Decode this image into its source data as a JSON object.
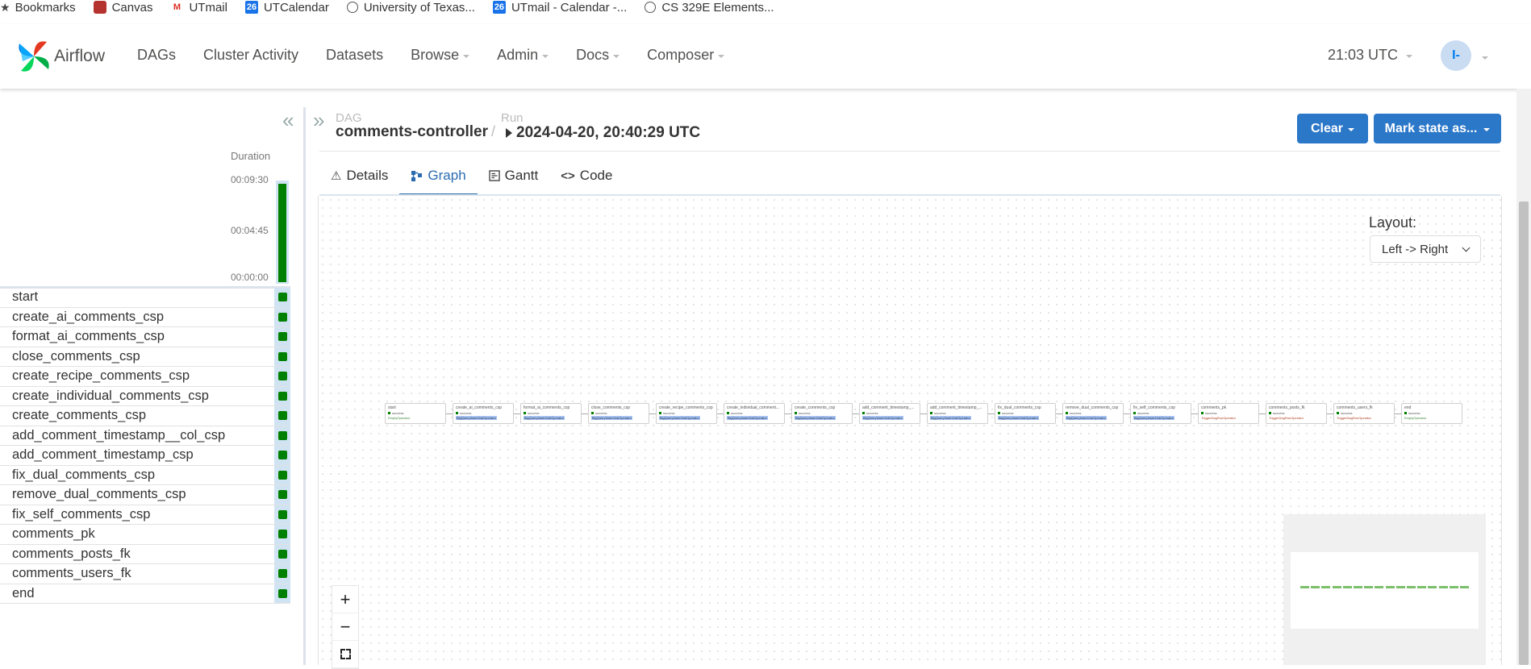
{
  "bookmarks": {
    "items": [
      {
        "label": "Bookmarks",
        "icon": "star-icon"
      },
      {
        "label": "Canvas",
        "icon": "canvas-icon"
      },
      {
        "label": "UTmail",
        "icon": "gmail-icon"
      },
      {
        "label": "UTCalendar",
        "icon": "calendar-icon",
        "badge": "26"
      },
      {
        "label": "University of Texas...",
        "icon": "globe-icon"
      },
      {
        "label": "UTmail - Calendar -...",
        "icon": "calendar-icon",
        "badge": "26"
      },
      {
        "label": "CS 329E Elements...",
        "icon": "globe-icon"
      }
    ]
  },
  "nav": {
    "brand": "Airflow",
    "items": [
      "DAGs",
      "Cluster Activity",
      "Datasets",
      "Browse",
      "Admin",
      "Docs",
      "Composer"
    ],
    "time": "21:03 UTC",
    "user_initials": "I-"
  },
  "grid": {
    "duration_label": "Duration",
    "ticks": [
      "00:09:30",
      "00:04:45",
      "00:00:00"
    ],
    "run_fraction": 1.0,
    "tasks": [
      "start",
      "create_ai_comments_csp",
      "format_ai_comments_csp",
      "close_comments_csp",
      "create_recipe_comments_csp",
      "create_individual_comments_csp",
      "create_comments_csp",
      "add_comment_timestamp__col_csp",
      "add_comment_timestamp_csp",
      "fix_dual_comments_csp",
      "remove_dual_comments_csp",
      "fix_self_comments_csp",
      "comments_pk",
      "comments_posts_fk",
      "comments_users_fk",
      "end"
    ],
    "status_color": "#008000"
  },
  "header": {
    "dag_label": "DAG",
    "dag_id": "comments-controller",
    "separator": "/",
    "run_label": "Run",
    "run_id": "2024-04-20, 20:40:29 UTC",
    "clear_button": "Clear",
    "mark_state_button": "Mark state as..."
  },
  "tabs": [
    {
      "label": "Details",
      "icon": "warning-icon",
      "active": false
    },
    {
      "label": "Graph",
      "icon": "graph-icon",
      "active": true
    },
    {
      "label": "Gantt",
      "icon": "gantt-icon",
      "active": false
    },
    {
      "label": "Code",
      "icon": "code-icon",
      "active": false
    }
  ],
  "graph": {
    "layout_label": "Layout:",
    "layout_value": "Left -> Right",
    "zoom_in": "+",
    "zoom_out": "−",
    "nodes": [
      {
        "name": "start",
        "status": "success",
        "operator": "EmptyOperator",
        "kind": "empty"
      },
      {
        "name": "create_ai_comments_csp",
        "status": "success",
        "operator": "BigQueryInsertJobOperator",
        "kind": "bq"
      },
      {
        "name": "format_ai_comments_csp",
        "status": "success",
        "operator": "BigQueryInsertJobOperator",
        "kind": "bq"
      },
      {
        "name": "close_comments_csp",
        "status": "success",
        "operator": "BigQueryInsertJobOperator",
        "kind": "bq"
      },
      {
        "name": "create_recipe_comments_csp",
        "status": "success",
        "operator": "BigQueryInsertJobOperator",
        "kind": "bq"
      },
      {
        "name": "create_individual_comment...",
        "status": "success",
        "operator": "BigQueryInsertJobOperator",
        "kind": "bq"
      },
      {
        "name": "create_comments_csp",
        "status": "success",
        "operator": "BigQueryInsertJobOperator",
        "kind": "bq"
      },
      {
        "name": "add_comment_timestamp_...",
        "status": "success",
        "operator": "BigQueryInsertJobOperator",
        "kind": "bq"
      },
      {
        "name": "add_comment_timestamp_...",
        "status": "success",
        "operator": "BigQueryInsertJobOperator",
        "kind": "bq"
      },
      {
        "name": "fix_dual_comments_csp",
        "status": "success",
        "operator": "BigQueryInsertJobOperator",
        "kind": "bq"
      },
      {
        "name": "remove_dual_comments_csp",
        "status": "success",
        "operator": "BigQueryInsertJobOperator",
        "kind": "bq"
      },
      {
        "name": "fix_self_comments_csp",
        "status": "success",
        "operator": "BigQueryInsertJobOperator",
        "kind": "bq"
      },
      {
        "name": "comments_pk",
        "status": "success",
        "operator": "TriggerDagRunOperator",
        "kind": "trig"
      },
      {
        "name": "comments_posts_fk",
        "status": "success",
        "operator": "TriggerDagRunOperator",
        "kind": "trig"
      },
      {
        "name": "comments_users_fk",
        "status": "success",
        "operator": "TriggerDagRunOperator",
        "kind": "trig"
      },
      {
        "name": "end",
        "status": "success",
        "operator": "EmptyOperator",
        "kind": "empty"
      }
    ]
  }
}
